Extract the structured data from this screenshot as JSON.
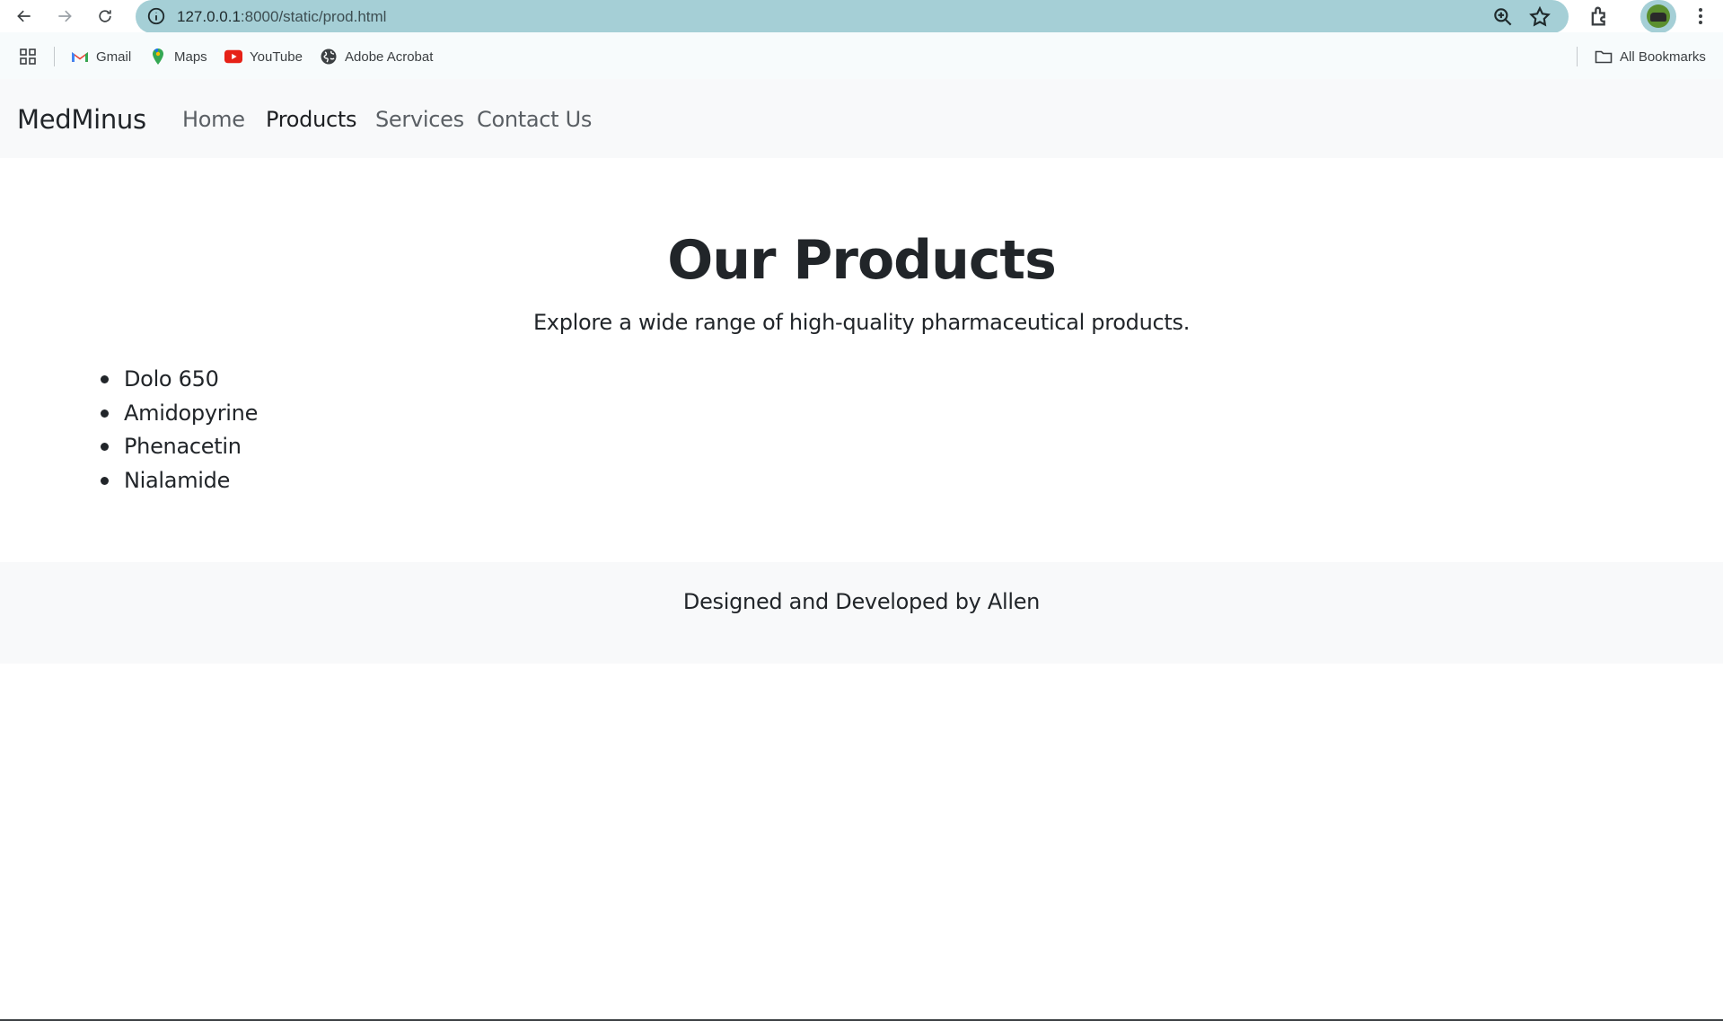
{
  "browser": {
    "url_host": "127.0.0.1",
    "url_path": ":8000/static/prod.html",
    "bookmarks": [
      {
        "label": "Gmail",
        "icon": "gmail-icon"
      },
      {
        "label": "Maps",
        "icon": "maps-icon"
      },
      {
        "label": "YouTube",
        "icon": "youtube-icon"
      },
      {
        "label": "Adobe Acrobat",
        "icon": "globe-icon"
      }
    ],
    "all_bookmarks_label": "All Bookmarks"
  },
  "site": {
    "brand": "MedMinus",
    "nav": [
      {
        "label": "Home",
        "active": false
      },
      {
        "label": "Products",
        "active": true
      },
      {
        "label": "Services",
        "active": false
      },
      {
        "label": "Contact Us",
        "active": false
      }
    ]
  },
  "main": {
    "heading": "Our Products",
    "lead": "Explore a wide range of high-quality pharmaceutical products.",
    "products": [
      "Dolo 650",
      "Amidopyrine",
      "Phenacetin",
      "Nialamide"
    ]
  },
  "footer": {
    "text": "Designed and Developed by Allen"
  },
  "colors": {
    "omnibox": "#a5cfd6",
    "navbar_bg": "#f8f9fa",
    "text": "#212529"
  }
}
